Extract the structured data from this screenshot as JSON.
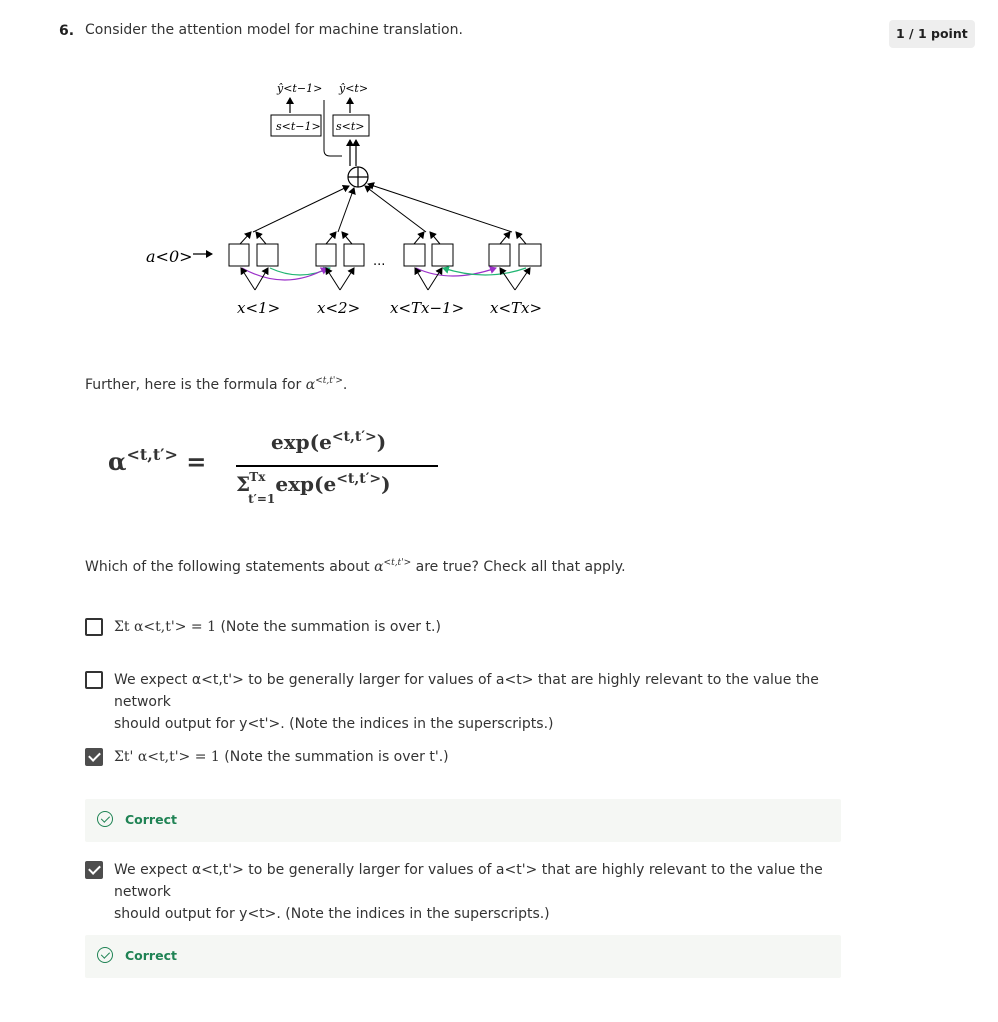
{
  "question": {
    "number": "6.",
    "text": "Consider the attention model for machine translation.",
    "points": "1 / 1 point"
  },
  "diagram": {
    "y_prev": "ŷ<t−1>",
    "y_curr": "ŷ<t>",
    "s_prev": "s<t−1>",
    "s_curr": "s<t>",
    "plus": "⊕",
    "a0": "a<0>",
    "dots": "...",
    "x1": "x<1>",
    "x2": "x<2>",
    "xtx1": "x<Tx−1>",
    "xtx": "x<Tx>"
  },
  "formula_intro": {
    "text": "Further, here is the formula for",
    "symbol": "α",
    "sup": "<t,t'>",
    "end": "."
  },
  "formula": {
    "lhs": "α<t,t'> =",
    "numerator": "exp(e<t,t'>)",
    "denominator": "Σt'=1Tx exp(e<t,t'>)"
  },
  "prompt": {
    "before": "Which of the following statements about",
    "symbol": "α",
    "sup": "<t,t'>",
    "after": "are true? Check all that apply."
  },
  "options": [
    {
      "checked": false,
      "math": "Σt α<t,t'> = 1",
      "text": "(Note the summation is over t.)"
    },
    {
      "checked": false,
      "line1": "We expect α<t,t'> to be generally larger for values of a<t> that are highly relevant to the value the network",
      "line2": "should output for y<t'>. (Note the indices in the superscripts.)"
    },
    {
      "checked": true,
      "math": "Σt' α<t,t'> = 1",
      "text": "(Note the summation is over t'.)"
    },
    {
      "checked": true,
      "line1": "We expect α<t,t'> to be generally larger for values of a<t'> that are highly relevant to the value the network",
      "line2": "should output for y<t>. (Note the indices in the superscripts.)"
    }
  ],
  "feedback": {
    "label": "Correct"
  },
  "colors": {
    "correct_green": "#1f8354",
    "feedback_bg": "#f5f7f4",
    "checkbox_checked": "#4d4d4d",
    "arrow_green": "#22b573",
    "arrow_purple": "#9b30c9"
  }
}
